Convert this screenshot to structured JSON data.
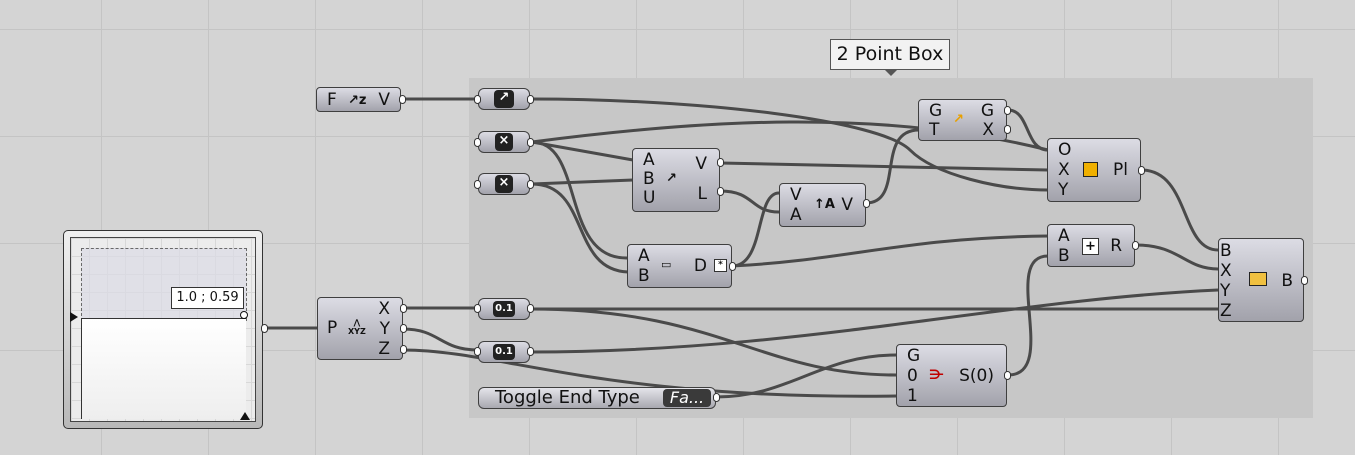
{
  "group": {
    "label": "2 Point Box"
  },
  "components": {
    "vector_fz": {
      "input": "F",
      "icon": "vector-z-icon",
      "output": "V"
    },
    "vector_param": {
      "icon": "vector-param-icon"
    },
    "point_param_1": {
      "icon": "point-param-icon"
    },
    "point_param_2": {
      "icon": "point-param-icon"
    },
    "two_point_vector": {
      "inputs": [
        "A",
        "B",
        "U"
      ],
      "icon": "two-point-vector-icon",
      "outputs": [
        "V",
        "L"
      ]
    },
    "amplitude": {
      "inputs": [
        "V",
        "A"
      ],
      "icon": "amplitude-icon",
      "output": "V"
    },
    "distance": {
      "inputs": [
        "A",
        "B"
      ],
      "icon": "ruler-icon",
      "output": "D"
    },
    "move": {
      "inputs": [
        "G",
        "T"
      ],
      "icon": "move-icon",
      "outputs": [
        "G",
        "X"
      ]
    },
    "plane_origin": {
      "inputs": [
        "O",
        "X",
        "Y"
      ],
      "icon": "plane-icon",
      "output": "Pl"
    },
    "addition": {
      "inputs": [
        "A",
        "B"
      ],
      "icon": "plus-icon",
      "output": "R"
    },
    "center_box": {
      "inputs": [
        "B",
        "X",
        "Y",
        "Z"
      ],
      "icon": "box-icon",
      "output": "B"
    },
    "deconstruct_point": {
      "input": "P",
      "icon": "xyz-icon",
      "outputs": [
        "X",
        "Y",
        "Z"
      ]
    },
    "number_param_1": {
      "label": "0.1"
    },
    "number_param_2": {
      "label": "0.1"
    },
    "stream_filter": {
      "inputs": [
        "G",
        "0",
        "1"
      ],
      "icon": "stream-filter-icon",
      "output": "S(0)"
    },
    "toggle": {
      "label": "Toggle End Type",
      "value": "Fa..."
    },
    "md_slider": {
      "value": "1.0 ; 0.59"
    }
  }
}
